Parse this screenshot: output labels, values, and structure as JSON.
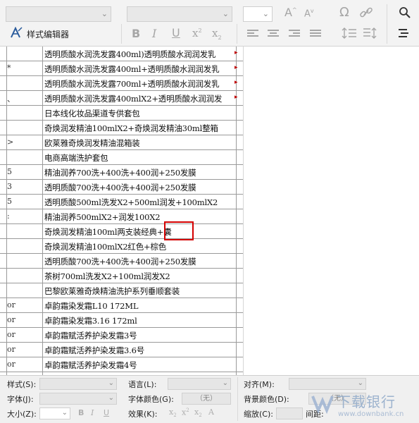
{
  "toolbar": {
    "style_editor_label": "样式编辑器",
    "icons": {
      "style_editor": "style-editor-icon",
      "font_grow": "A",
      "font_shrink": "A",
      "omega": "Ω",
      "bold": "B",
      "italic": "I",
      "underline": "U",
      "superscript": "x",
      "subscript": "x",
      "sup_mark": "2",
      "sub_mark": "2",
      "search_icon": "search-icon",
      "link_icon": "link-icon"
    },
    "search_text": "Q"
  },
  "grid": {
    "rows": [
      {
        "c1": "",
        "c2": "透明质酸水润洗发露400ml)透明质酸水润润发乳",
        "overflow": true
      },
      {
        "c1": "*",
        "c2": "透明质酸水润洗发露400ml+透明质酸水润润发乳",
        "overflow": true
      },
      {
        "c1": "",
        "c2": "透明质酸水润洗发露700ml+透明质酸水润润发乳",
        "overflow": true
      },
      {
        "c1": "、",
        "c2": "透明质酸水润洗发露400mlX2+透明质酸水润润发",
        "overflow": true
      },
      {
        "c1": "",
        "c2": " 日本线化妆品渠道专供套包",
        "overflow": false
      },
      {
        "c1": "",
        "c2": "奇焕润发精油100mlX2+奇焕润发精油30ml整箱",
        "overflow": false
      },
      {
        "c1": ">",
        "c2": "欧莱雅奇焕润发精油混箱装",
        "overflow": false
      },
      {
        "c1": "",
        "c2": "电商高端洗护套包",
        "overflow": false
      },
      {
        "c1": "5",
        "c2": "精油润养700洗+400洗+400润+250发膜",
        "overflow": false
      },
      {
        "c1": "3",
        "c2": "透明质酸700洗+400洗+400润+250发膜",
        "overflow": false
      },
      {
        "c1": "5",
        "c2": "透明质酸500ml洗发X2+500ml润发+100mlX2",
        "overflow": false
      },
      {
        "c1": ":",
        "c2": "精油润养500mlX2+润发100X2",
        "overflow": false
      },
      {
        "c1": "",
        "c2": "奇焕润发精油100ml两支装经典+囊",
        "overflow": false
      },
      {
        "c1": "",
        "c2": "奇焕润发精油100mlX2红色+棕色",
        "overflow": false
      },
      {
        "c1": "",
        "c2": "透明质酸700洗+400洗+400润+250发膜",
        "overflow": false
      },
      {
        "c1": "",
        "c2": "茶树700ml洗发X2+100ml润发X2",
        "overflow": false
      },
      {
        "c1": "",
        "c2": " 巴黎欧莱雅奇焕精油洗护系列垂顺套装",
        "overflow": false
      },
      {
        "c1": "or",
        "c2": "卓韵霜染发霜L10 172ML",
        "overflow": false
      },
      {
        "c1": "or",
        "c2": "卓韵霜染发霜3.16 172ml",
        "overflow": false
      },
      {
        "c1": "or",
        "c2": "卓韵霜赋活养护染发霜3号",
        "overflow": false
      },
      {
        "c1": "or",
        "c2": "卓韵霜赋活养护染发霜3.6号",
        "overflow": false
      },
      {
        "c1": "or",
        "c2": "卓韵霜赋活养护染发霜4号",
        "overflow": false
      }
    ]
  },
  "bottom": {
    "style_label": "样式(S):",
    "font_label": "字体(J):",
    "size_label": "大小(Z):",
    "language_label": "语言(L):",
    "font_color_label": "字体颜色(G):",
    "font_color_value": "（无）",
    "effect_label": "效果(K):",
    "align_label": "对齐(M):",
    "bg_color_label": "背景颜色(D):",
    "bg_color_value": "（无）",
    "zoom_label": "缩放(C):",
    "spacing_label": "间距:",
    "bold": "B",
    "italic": "I",
    "underline": "U"
  },
  "watermark": {
    "text": "下载银行",
    "sub": "www.downbank.cn"
  },
  "colors": {
    "highlight": "#d40000",
    "toolbar_bg": "#f3f3f3",
    "grid_line": "#9a9a9a"
  }
}
